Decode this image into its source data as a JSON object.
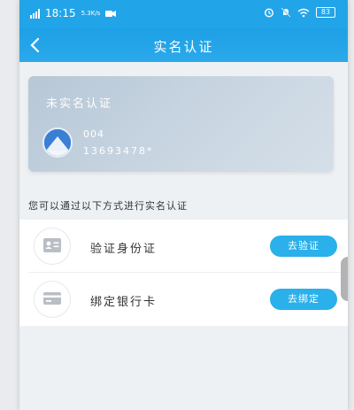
{
  "status_bar": {
    "time": "18:15",
    "speed": "5.3K/s",
    "battery": "83"
  },
  "nav": {
    "title": "实名认证",
    "back_icon": "chevron-left-icon"
  },
  "card": {
    "title": "未实名认证",
    "name": "004",
    "phone": "13693478*"
  },
  "hint": "您可以通过以下方式进行实名认证",
  "methods": [
    {
      "label": "验证身份证",
      "icon": "id-card-icon",
      "action": "去验证"
    },
    {
      "label": "绑定银行卡",
      "icon": "bank-card-icon",
      "action": "去绑定"
    }
  ],
  "colors": {
    "primary": "#22a4e8",
    "button": "#2ab0ea",
    "card": "#c3d1de"
  }
}
